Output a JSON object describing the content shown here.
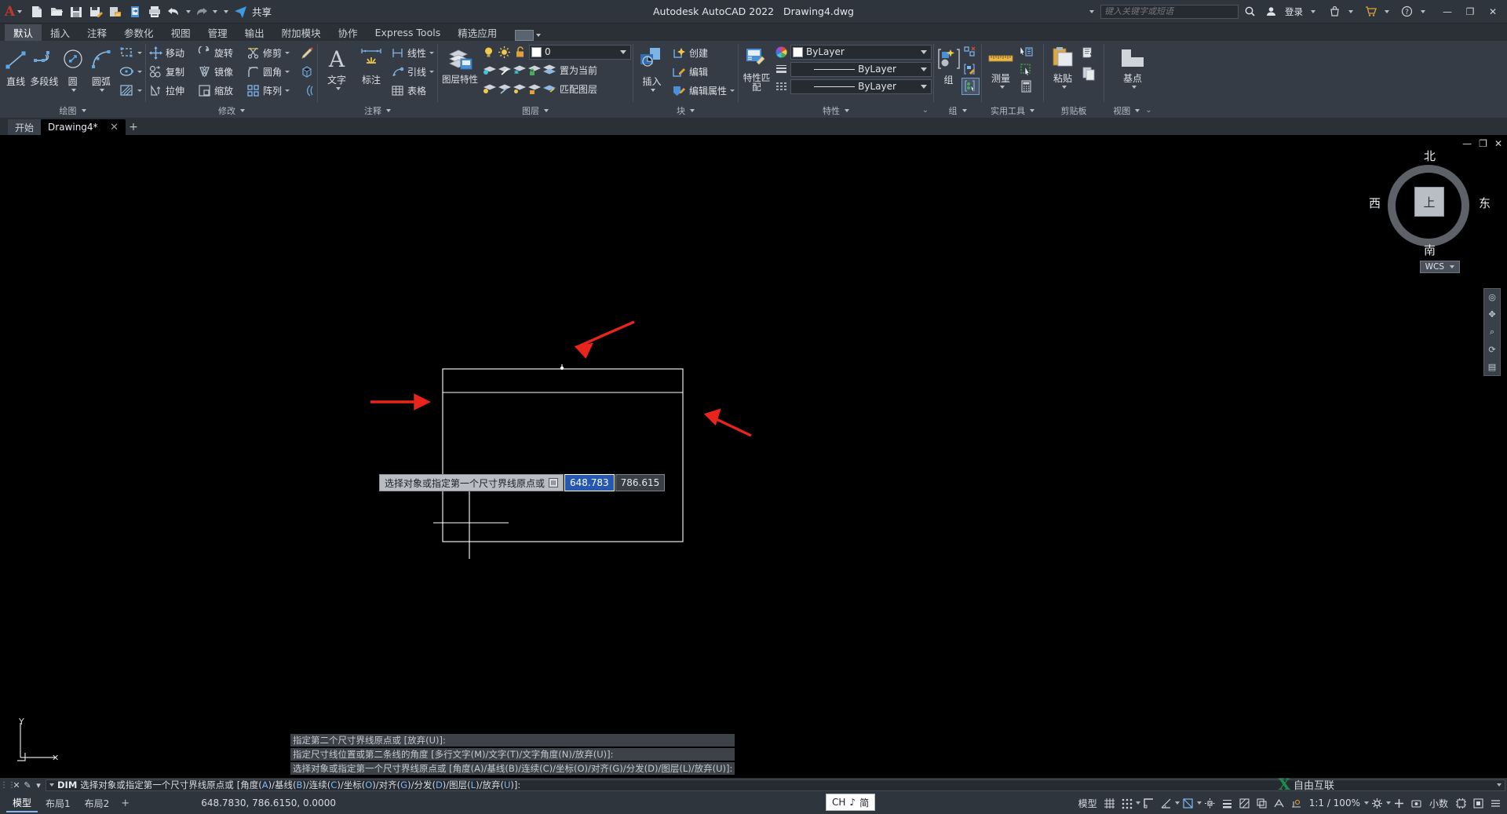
{
  "app": {
    "title": "Autodesk AutoCAD 2022",
    "document": "Drawing4.dwg",
    "logo": "A"
  },
  "quick_access": {
    "items": [
      {
        "name": "new-icon",
        "label": "新建"
      },
      {
        "name": "open-icon",
        "label": "打开"
      },
      {
        "name": "save-icon",
        "label": "保存"
      },
      {
        "name": "saveas-icon",
        "label": "另存为"
      },
      {
        "name": "cloud-save-icon",
        "label": "保存到 Web 和 Mobile"
      },
      {
        "name": "cloud-open-icon",
        "label": "从 Web 和 Mobile 打开"
      },
      {
        "name": "plot-icon",
        "label": "打印"
      },
      {
        "name": "undo-icon",
        "label": "放弃"
      },
      {
        "name": "redo-icon",
        "label": "重做"
      }
    ],
    "share_label": "共享"
  },
  "search": {
    "placeholder": "键入关键字或短语",
    "icon": "search-icon"
  },
  "account": {
    "sign_in": "登录",
    "icons": [
      "person-icon",
      "app-store-icon",
      "cart-icon",
      "help-icon"
    ]
  },
  "window_controls": {
    "minimize": "—",
    "maximize": "❐",
    "close": "✕"
  },
  "ribbon": {
    "tabs": [
      {
        "label": "默认",
        "active": true
      },
      {
        "label": "插入",
        "active": false
      },
      {
        "label": "注释",
        "active": false
      },
      {
        "label": "参数化",
        "active": false
      },
      {
        "label": "视图",
        "active": false
      },
      {
        "label": "管理",
        "active": false
      },
      {
        "label": "输出",
        "active": false
      },
      {
        "label": "附加模块",
        "active": false
      },
      {
        "label": "协作",
        "active": false
      },
      {
        "label": "Express Tools",
        "active": false
      },
      {
        "label": "精选应用",
        "active": false
      }
    ],
    "panels": [
      {
        "title": "绘图",
        "big_buttons": [
          {
            "label": "直线",
            "icon": "line-icon"
          },
          {
            "label": "多段线",
            "icon": "polyline-icon"
          },
          {
            "label": "圆",
            "icon": "circle-icon",
            "dropdown": true
          },
          {
            "label": "圆弧",
            "icon": "arc-icon",
            "dropdown": true
          }
        ],
        "small_buttons": [
          {
            "label": "",
            "icon": "rectangle-icon",
            "dropdown": true
          },
          {
            "label": "",
            "icon": "ellipse-icon",
            "dropdown": true
          },
          {
            "label": "",
            "icon": "hatch-icon",
            "dropdown": true
          }
        ]
      },
      {
        "title": "修改",
        "rows": [
          [
            {
              "label": "移动",
              "icon": "move-icon"
            },
            {
              "label": "旋转",
              "icon": "rotate-icon"
            },
            {
              "label": "修剪",
              "icon": "trim-icon",
              "dropdown": true
            },
            {
              "label": "",
              "icon": "erase-brush-icon"
            }
          ],
          [
            {
              "label": "复制",
              "icon": "copy-icon"
            },
            {
              "label": "镜像",
              "icon": "mirror-icon"
            },
            {
              "label": "圆角",
              "icon": "fillet-icon",
              "dropdown": true
            },
            {
              "label": "",
              "icon": "explode-icon"
            }
          ],
          [
            {
              "label": "拉伸",
              "icon": "stretch-icon"
            },
            {
              "label": "缩放",
              "icon": "scale-icon"
            },
            {
              "label": "阵列",
              "icon": "array-icon",
              "dropdown": true
            },
            {
              "label": "",
              "icon": "offset-icon"
            }
          ]
        ]
      },
      {
        "title": "注释",
        "big_buttons": [
          {
            "label": "文字",
            "icon": "text-icon",
            "dropdown": true
          },
          {
            "label": "标注",
            "icon": "dimension-icon"
          }
        ],
        "small_buttons": [
          {
            "label": "线性",
            "icon": "linear-dim-icon",
            "dropdown": true
          },
          {
            "label": "引线",
            "icon": "leader-icon",
            "dropdown": true
          },
          {
            "label": "表格",
            "icon": "table-icon"
          }
        ]
      },
      {
        "title": "图层",
        "big_buttons": [
          {
            "label": "图层特性",
            "icon": "layer-properties-icon"
          }
        ],
        "layer_combo": {
          "value": "0",
          "color": "#ffffff"
        },
        "toggle_icons": [
          "lightbulb-icon",
          "sun-icon",
          "unlock-icon"
        ],
        "row2_icons": [
          "layer-off-icon",
          "layer-isolate-icon",
          "layer-freeze-icon",
          "layer-lock-icon"
        ],
        "row3_icons": [
          "layer-on-icon",
          "layer-unisolate-icon",
          "layer-thaw-icon",
          "layer-unlock-icon"
        ],
        "row2_label": "置为当前",
        "row3_label": "匹配图层"
      },
      {
        "title": "块",
        "big_buttons": [
          {
            "label": "插入",
            "icon": "insert-block-icon",
            "dropdown": true
          }
        ],
        "small_buttons": [
          {
            "label": "创建",
            "icon": "create-block-icon"
          },
          {
            "label": "编辑",
            "icon": "edit-block-icon"
          },
          {
            "label": "编辑属性",
            "icon": "edit-attributes-icon",
            "dropdown": true
          }
        ]
      },
      {
        "title": "特性",
        "big_buttons": [
          {
            "label": "特性匹配",
            "icon": "match-properties-icon"
          }
        ],
        "combos": [
          {
            "value": "ByLayer",
            "icon": "color-wheel-icon",
            "type": "color"
          },
          {
            "value": "ByLayer",
            "icon": "linewidth-icon",
            "type": "linewidth"
          },
          {
            "value": "ByLayer",
            "icon": "linetype-icon",
            "type": "linetype"
          }
        ]
      },
      {
        "title": "组",
        "big_buttons": [
          {
            "label": "组",
            "icon": "group-icon"
          }
        ],
        "small_buttons": [
          {
            "label": "",
            "icon": "ungroup-icon"
          },
          {
            "label": "",
            "icon": "group-edit-icon"
          },
          {
            "label": "",
            "icon": "group-selection-icon",
            "active": true
          }
        ]
      },
      {
        "title": "实用工具",
        "big_buttons": [
          {
            "label": "测量",
            "icon": "measure-icon",
            "dropdown": true
          }
        ],
        "small_buttons": [
          {
            "label": "",
            "icon": "quick-select-icon"
          },
          {
            "label": "",
            "icon": "select-all-icon"
          },
          {
            "label": "",
            "icon": "calculator-icon"
          }
        ]
      },
      {
        "title": "剪贴板",
        "big_buttons": [
          {
            "label": "粘贴",
            "icon": "paste-icon",
            "dropdown": true
          }
        ],
        "small_buttons": [
          {
            "label": "",
            "icon": "cut-icon"
          },
          {
            "label": "",
            "icon": "copy-clip-icon"
          }
        ]
      },
      {
        "title": "视图",
        "big_buttons": [
          {
            "label": "基点",
            "icon": "base-point-icon",
            "dropdown": true
          }
        ]
      }
    ]
  },
  "document_tabs": [
    {
      "label": "开始",
      "active": false,
      "closable": false
    },
    {
      "label": "Drawing4*",
      "active": true,
      "closable": true
    }
  ],
  "document_tab_add": "+",
  "drawing": {
    "viewcube": {
      "north": "北",
      "south": "南",
      "west": "西",
      "east": "东",
      "face": "上"
    },
    "wcs_label": "WCS",
    "dynamic_input": {
      "prompt": "选择对象或指定第一个尺寸界线原点或",
      "field_x": "648.783",
      "field_y": "786.615"
    },
    "history": [
      "指定第二个尺寸界线原点或 [放弃(U)]:",
      "指定尺寸线位置或第二条线的角度 [多行文字(M)/文字(T)/文字角度(N)/放弃(U)]:",
      "选择对象或指定第一个尺寸界线原点或 [角度(A)/基线(B)/连续(C)/坐标(O)/对齐(G)/分发(D)/图层(L)/放弃(U)]:"
    ]
  },
  "command_line": {
    "command": "DIM",
    "prompt_prefix": "选择对象或指定第一个尺寸界线原点或",
    "options_open": "[",
    "options": [
      {
        "text": "角度",
        "key": "A"
      },
      {
        "text": "基线",
        "key": "B"
      },
      {
        "text": "连续",
        "key": "C"
      },
      {
        "text": "坐标",
        "key": "O"
      },
      {
        "text": "对齐",
        "key": "G"
      },
      {
        "text": "分发",
        "key": "D"
      },
      {
        "text": "图层",
        "key": "L"
      },
      {
        "text": "放弃",
        "key": "U"
      }
    ],
    "options_close": "]:"
  },
  "status_bar": {
    "layout_tabs": [
      {
        "label": "模型",
        "active": true
      },
      {
        "label": "布局1",
        "active": false
      },
      {
        "label": "布局2",
        "active": false
      }
    ],
    "layout_add": "+",
    "coordinates": "648.7830, 786.6150, 0.0000",
    "model_label": "模型",
    "scale": "1:1 / 100%",
    "decimal_label": "小数",
    "icons": [
      "model-space-icon",
      "grid-icon",
      "snap-icon",
      "ortho-icon",
      "polar-icon",
      "osnap-icon",
      "otrack-icon",
      "lineweight-icon",
      "transparency-icon",
      "selection-cycling-icon",
      "annotation-visibility-icon",
      "workspace-icon",
      "customization-icon",
      "fullscreen-icon"
    ]
  },
  "ime": {
    "text": "CH",
    "mode": "简",
    "icon": "music-note-icon"
  },
  "watermark": {
    "text": "自由互联",
    "logo": "X"
  }
}
